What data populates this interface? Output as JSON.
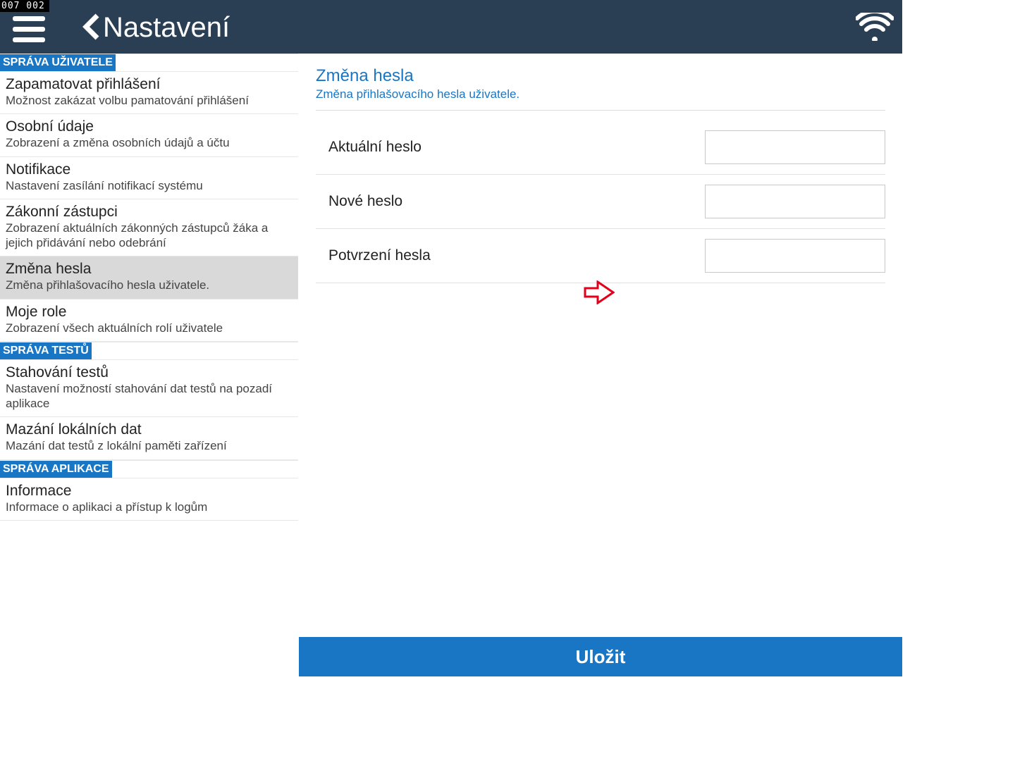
{
  "badge": "007  002",
  "header": {
    "title": "Nastavení"
  },
  "sidebar": {
    "sections": [
      {
        "header": "SPRÁVA UŽIVATELE",
        "items": [
          {
            "title": "Zapamatovat přihlášení",
            "sub": "Možnost zakázat volbu pamatování přihlášení",
            "selected": false
          },
          {
            "title": "Osobní údaje",
            "sub": "Zobrazení a změna osobních údajů a účtu",
            "selected": false
          },
          {
            "title": "Notifikace",
            "sub": "Nastavení zasílání notifikací systému",
            "selected": false
          },
          {
            "title": "Zákonní zástupci",
            "sub": "Zobrazení aktuálních zákonných zástupců žáka a jejich přidávání nebo odebrání",
            "selected": false
          },
          {
            "title": "Změna hesla",
            "sub": "Změna přihlašovacího hesla uživatele.",
            "selected": true
          },
          {
            "title": "Moje role",
            "sub": "Zobrazení všech aktuálních rolí uživatele",
            "selected": false
          }
        ]
      },
      {
        "header": "SPRÁVA TESTŮ",
        "items": [
          {
            "title": "Stahování testů",
            "sub": "Nastavení možností stahování dat testů na pozadí aplikace",
            "selected": false
          },
          {
            "title": "Mazání lokálních dat",
            "sub": "Mazání dat testů z lokální paměti zařízení",
            "selected": false
          }
        ]
      },
      {
        "header": "SPRÁVA APLIKACE",
        "items": [
          {
            "title": "Informace",
            "sub": "Informace o aplikaci a přístup k logům",
            "selected": false
          }
        ]
      }
    ]
  },
  "content": {
    "title": "Změna hesla",
    "sub": "Změna přihlašovacího hesla uživatele.",
    "fields": [
      {
        "label": "Aktuální heslo",
        "value": ""
      },
      {
        "label": "Nové heslo",
        "value": ""
      },
      {
        "label": "Potvrzení hesla",
        "value": ""
      }
    ],
    "save_label": "Uložit"
  }
}
